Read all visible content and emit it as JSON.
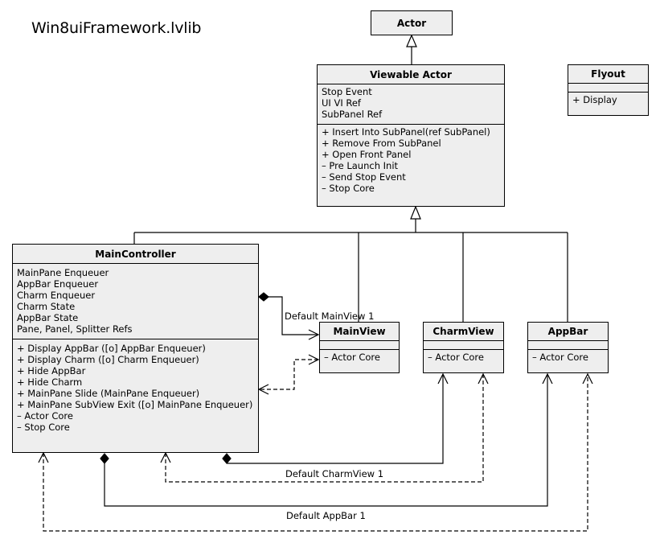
{
  "title": "Win8uiFramework.lvlib",
  "classes": {
    "actor": {
      "name": "Actor",
      "attributes": [],
      "operations": []
    },
    "viewable_actor": {
      "name": "Viewable Actor",
      "attributes": [
        "Stop Event",
        "UI VI Ref",
        "SubPanel Ref"
      ],
      "operations": [
        "+ Insert Into SubPanel(ref SubPanel)",
        "+ Remove From SubPanel",
        "+ Open Front Panel",
        "– Pre Launch Init",
        "– Send Stop Event",
        "– Stop Core"
      ]
    },
    "flyout": {
      "name": "Flyout",
      "attributes": [],
      "operations": [
        "+ Display"
      ]
    },
    "main_controller": {
      "name": "MainController",
      "attributes": [
        "MainPane Enqueuer",
        "AppBar Enqueuer",
        "Charm Enqueuer",
        "Charm State",
        "AppBar State",
        "Pane, Panel, Splitter Refs"
      ],
      "operations": [
        "+ Display AppBar ([o] AppBar Enqueuer)",
        "+ Display Charm ([o] Charm Enqueuer)",
        "+ Hide AppBar",
        "+ Hide Charm",
        "+ MainPane Slide (MainPane Enqueuer)",
        "+ MainPane SubView Exit ([o] MainPane Enqueuer)",
        "– Actor Core",
        "– Stop Core"
      ]
    },
    "main_view": {
      "name": "MainView",
      "attributes": [],
      "operations": [
        "– Actor Core"
      ]
    },
    "charm_view": {
      "name": "CharmView",
      "attributes": [],
      "operations": [
        "– Actor Core"
      ]
    },
    "app_bar": {
      "name": "AppBar",
      "attributes": [],
      "operations": [
        "– Actor Core"
      ]
    }
  },
  "relations": {
    "default_mainview": "Default MainView 1",
    "default_charmview": "Default CharmView 1",
    "default_appbar": "Default AppBar 1"
  },
  "colors": {
    "class_fill": "#eeeeee",
    "stroke": "#000000",
    "background": "#ffffff"
  }
}
